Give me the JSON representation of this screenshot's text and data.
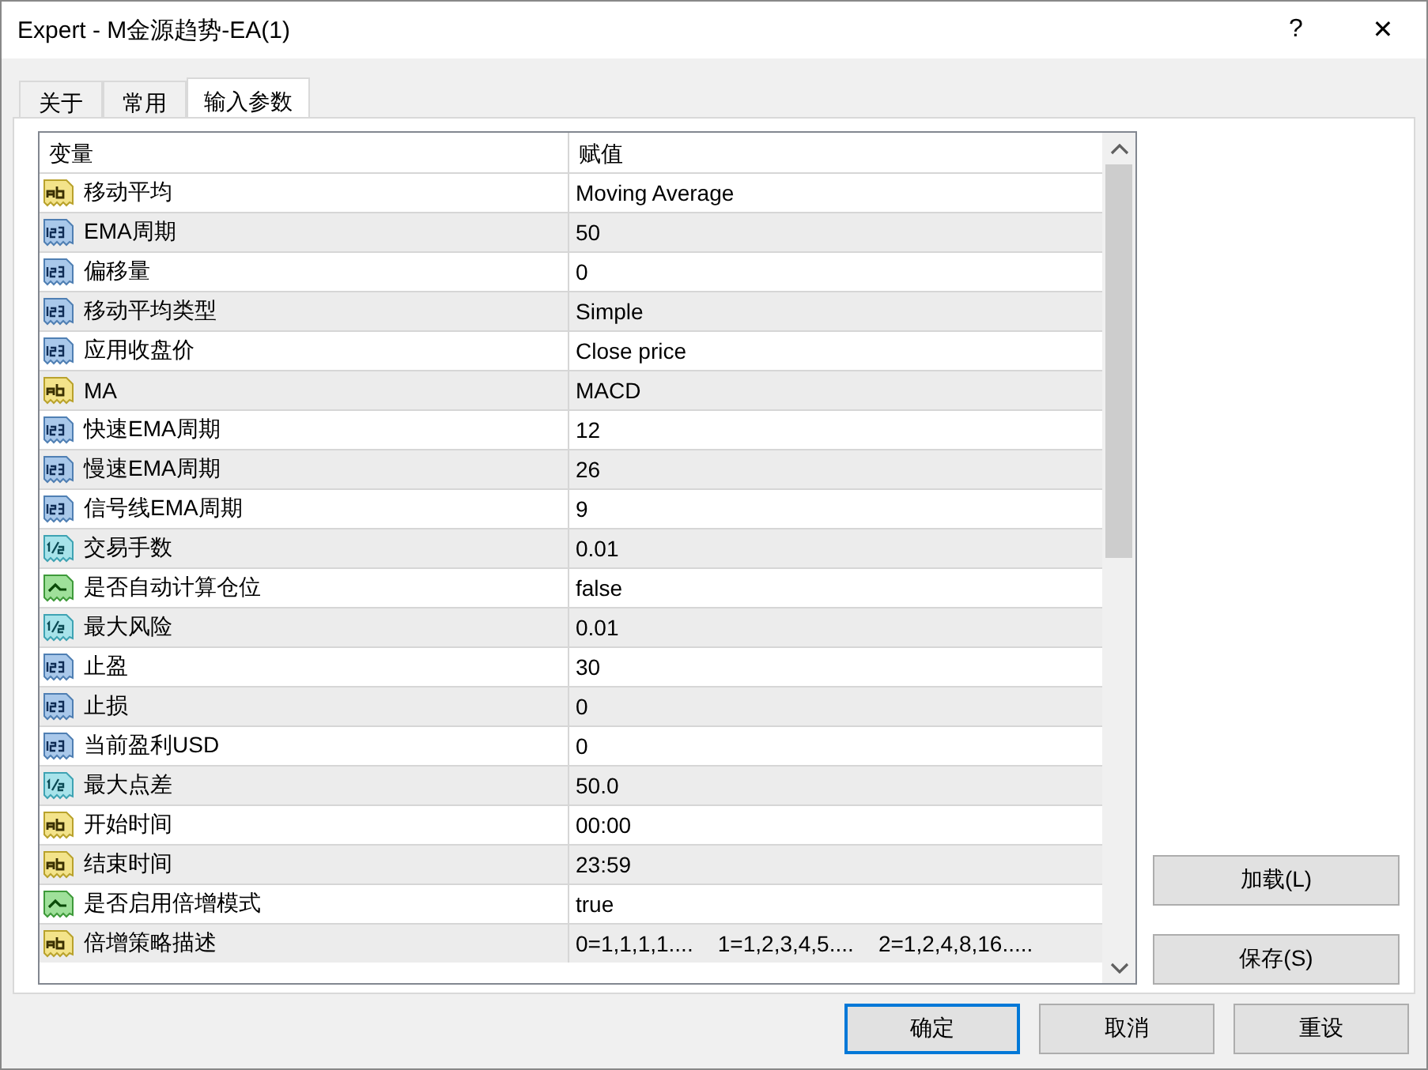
{
  "window": {
    "title": "Expert - M金源趋势-EA(1)",
    "help": "?",
    "close": "✕"
  },
  "tabs": [
    {
      "label": "关于",
      "selected": false
    },
    {
      "label": "常用",
      "selected": false
    },
    {
      "label": "输入参数",
      "selected": true
    }
  ],
  "table": {
    "columns": [
      "变量",
      "赋值"
    ],
    "rows": [
      {
        "kind": "string",
        "name": "移动平均",
        "value": "Moving Average"
      },
      {
        "kind": "int",
        "name": "EMA周期",
        "value": "50"
      },
      {
        "kind": "int",
        "name": "偏移量",
        "value": "0"
      },
      {
        "kind": "int",
        "name": "移动平均类型",
        "value": "Simple"
      },
      {
        "kind": "int",
        "name": "应用收盘价",
        "value": "Close price"
      },
      {
        "kind": "string",
        "name": "MA",
        "value": "MACD"
      },
      {
        "kind": "int",
        "name": "快速EMA周期",
        "value": "12"
      },
      {
        "kind": "int",
        "name": "慢速EMA周期",
        "value": "26"
      },
      {
        "kind": "int",
        "name": "信号线EMA周期",
        "value": "9"
      },
      {
        "kind": "double",
        "name": "交易手数",
        "value": "0.01"
      },
      {
        "kind": "bool",
        "name": "是否自动计算仓位",
        "value": "false"
      },
      {
        "kind": "double",
        "name": "最大风险",
        "value": "0.01"
      },
      {
        "kind": "int",
        "name": "止盈",
        "value": "30"
      },
      {
        "kind": "int",
        "name": "止损",
        "value": "0"
      },
      {
        "kind": "int",
        "name": "当前盈利USD",
        "value": "0"
      },
      {
        "kind": "double",
        "name": "最大点差",
        "value": "50.0"
      },
      {
        "kind": "string",
        "name": "开始时间",
        "value": "00:00"
      },
      {
        "kind": "string",
        "name": "结束时间",
        "value": "23:59"
      },
      {
        "kind": "bool",
        "name": "是否启用倍增模式",
        "value": "true"
      },
      {
        "kind": "string",
        "name": "倍增策略描述",
        "value": "0=1,1,1,1....    1=1,2,3,4,5....    2=1,2,4,8,16....."
      }
    ]
  },
  "side_buttons": [
    "加载(L)",
    "保存(S)"
  ],
  "buttons": [
    {
      "label": "确定",
      "default": true
    },
    {
      "label": "取消",
      "default": false
    },
    {
      "label": "重设",
      "default": false
    }
  ]
}
